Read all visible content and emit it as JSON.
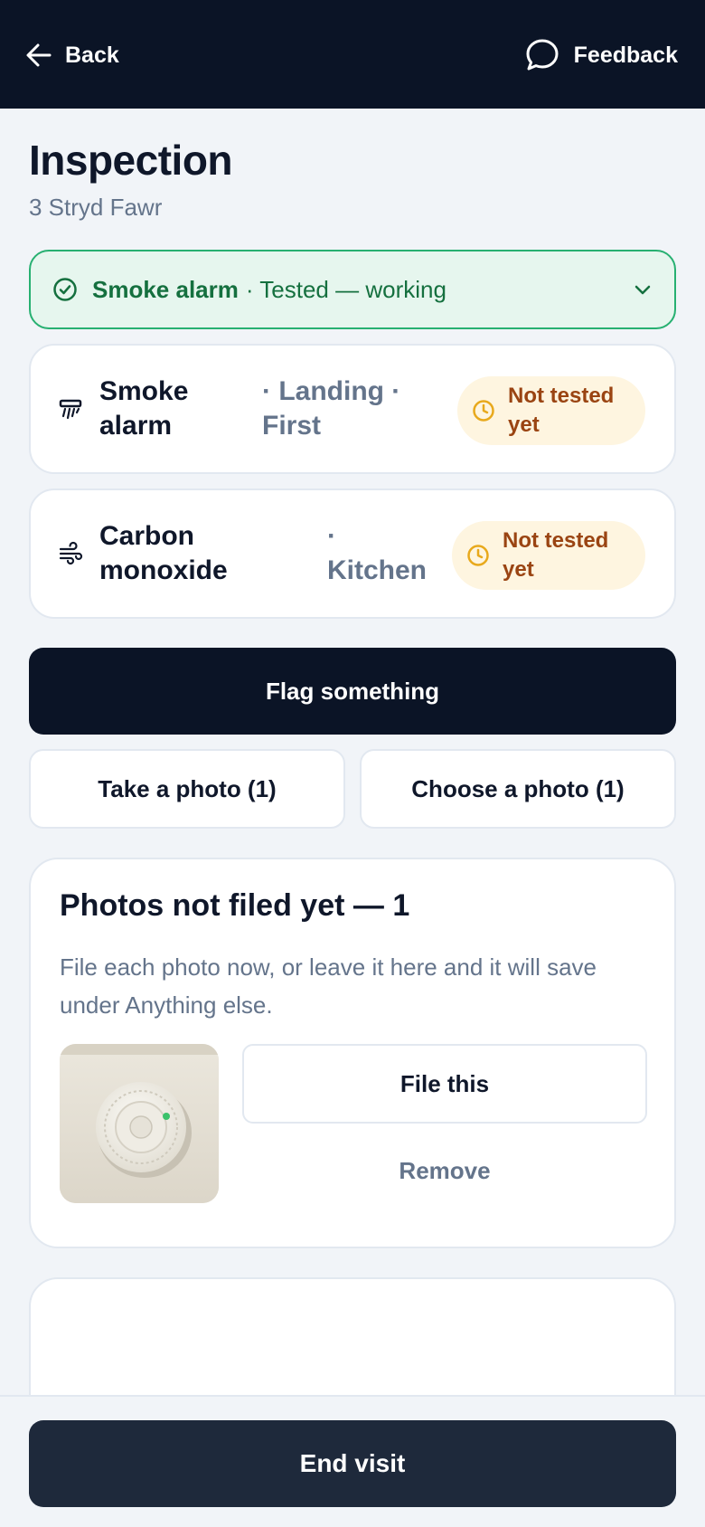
{
  "header": {
    "back_label": "Back",
    "feedback_label": "Feedback",
    "back_icon": "arrow-left-icon",
    "feedback_icon": "speech-bubble-icon"
  },
  "page": {
    "title": "Inspection",
    "address": "3 Stryd Fawr"
  },
  "tested_banner": {
    "name": "Smoke alarm",
    "status": "· Tested — working",
    "icon": "check-circle-icon"
  },
  "alarms": [
    {
      "name_lines": [
        "Smoke",
        "alarm"
      ],
      "location_lines": [
        "· Landing ·",
        "First"
      ],
      "badge_lines": [
        "Not tested",
        "yet"
      ],
      "icon": "smoke-alarm-icon"
    },
    {
      "name_lines": [
        "Carbon",
        "monoxide"
      ],
      "location_lines": [
        "·",
        "Kitchen"
      ],
      "badge_lines": [
        "Not tested",
        "yet"
      ],
      "icon": "wind-icon"
    }
  ],
  "actions": {
    "flag_label": "Flag something",
    "take_photo_label": "Take a photo (1)",
    "choose_photo_label": "Choose a photo (1)"
  },
  "photos_panel": {
    "title": "Photos not filed yet — 1",
    "description": "File each photo now, or leave it here and it will save under Anything else.",
    "file_label": "File this",
    "remove_label": "Remove"
  },
  "footer": {
    "end_visit_label": "End visit"
  },
  "colors": {
    "topbar": "#0b1426",
    "success_bg": "#e6f6ee",
    "success_border": "#27b071",
    "success_text": "#15703f",
    "badge_bg": "#fef5e0",
    "badge_text": "#9a4412",
    "badge_icon": "#e8a91c",
    "end_visit_bg": "#1e293b"
  }
}
